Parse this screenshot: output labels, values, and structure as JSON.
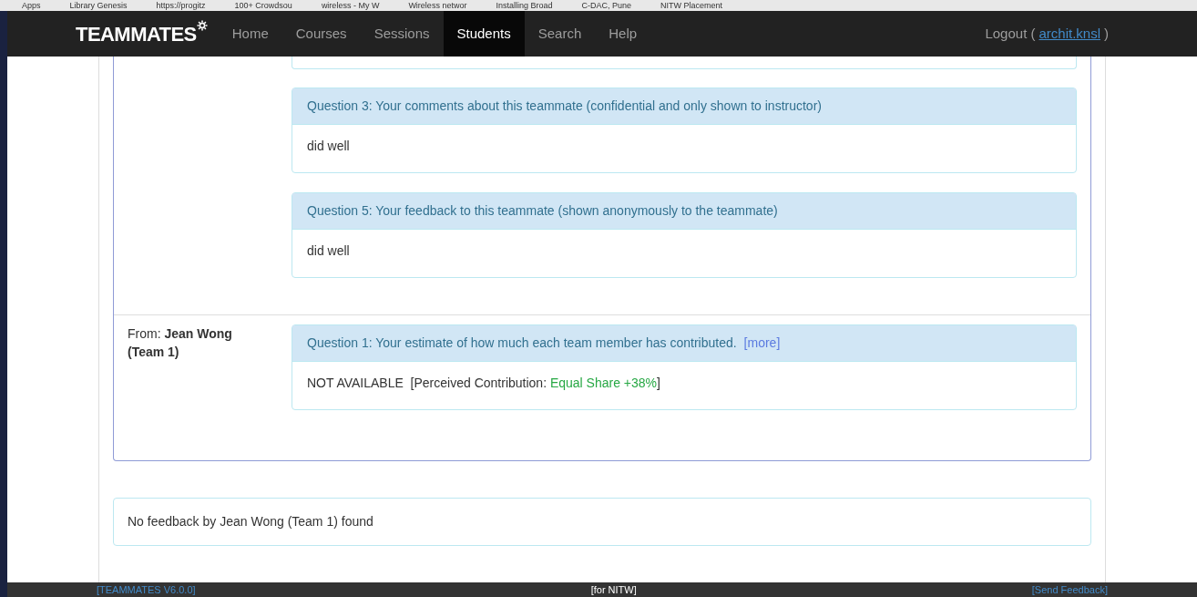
{
  "bookmarks": [
    "Apps",
    "Library Genesis",
    "https://progitz",
    "100+ Crowdsou",
    "wireless - My W",
    "Wireless networ",
    "Installing Broad",
    "C-DAC, Pune",
    "NITW Placement"
  ],
  "navbar": {
    "brand": "TEAMMATES",
    "items": [
      {
        "label": "Home",
        "selected": false
      },
      {
        "label": "Courses",
        "selected": false
      },
      {
        "label": "Sessions",
        "selected": false
      },
      {
        "label": "Students",
        "selected": true
      },
      {
        "label": "Search",
        "selected": false
      },
      {
        "label": "Help",
        "selected": false
      }
    ],
    "logout": "Logout (",
    "user": "archit.knsl",
    "close": ")"
  },
  "groups": [
    {
      "questions": [
        {
          "question": "Question 3: Your comments about this teammate (confidential and only shown to instructor)",
          "answer": {
            "text": "did well"
          }
        },
        {
          "question": "Question 5: Your feedback to this teammate (shown anonymously to the teammate)",
          "answer": {
            "text": "did well"
          }
        }
      ]
    },
    {
      "giver": "From: **Jean Wong (Team 1)**",
      "questions": [
        {
          "question": "Question 1: Your estimate of how much each team member has contributed.",
          "more": "[more]",
          "answer": {
            "text": "NOT AVAILABLE  [Perceived Contribution: ",
            "highlight": "Equal Share +38%",
            "suffix": "]"
          }
        }
      ]
    }
  ],
  "no_feedback": "No feedback by Jean Wong (Team 1) found",
  "footer": {
    "version": "[TEAMMATES V6.0.0]",
    "institute": "[for NITW]",
    "feedback": "[Send Feedback]"
  }
}
